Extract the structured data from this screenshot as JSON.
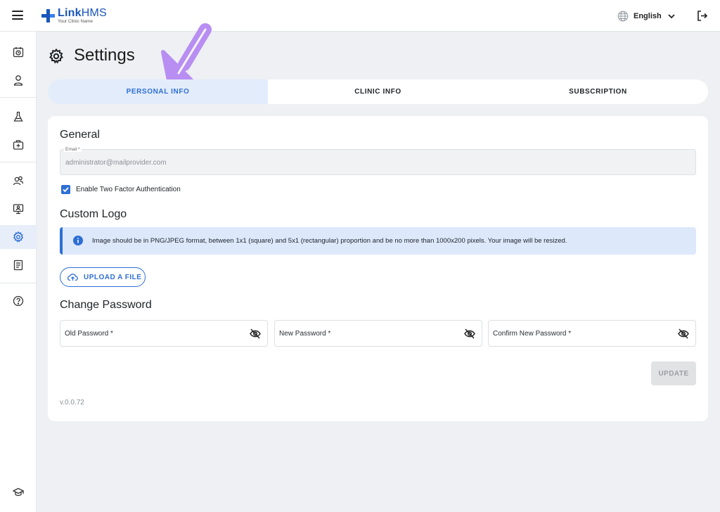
{
  "app": {
    "logo_name": "Link",
    "logo_name_suffix": "HMS",
    "logo_subtitle": "Your Clinic Name"
  },
  "header": {
    "language": "English"
  },
  "sidebar": {
    "items": [
      {
        "icon": "calendar-clock-icon"
      },
      {
        "icon": "person-icon"
      },
      {
        "icon": "lab-flask-icon"
      },
      {
        "icon": "medical-kit-icon"
      },
      {
        "icon": "patients-icon"
      },
      {
        "icon": "monitor-user-icon"
      },
      {
        "icon": "gear-icon",
        "active": true
      },
      {
        "icon": "report-list-icon"
      },
      {
        "icon": "help-icon"
      },
      {
        "icon": "graduation-cap-icon"
      }
    ]
  },
  "page": {
    "title": "Settings"
  },
  "tabs": [
    {
      "label": "PERSONAL INFO",
      "active": true
    },
    {
      "label": "CLINIC INFO",
      "active": false
    },
    {
      "label": "SUBSCRIPTION",
      "active": false
    }
  ],
  "general": {
    "heading": "General",
    "email_label": "Email *",
    "email_value": "administrator@mailprovider.com",
    "two_factor_label": "Enable Two Factor Authentication",
    "two_factor_checked": true
  },
  "custom_logo": {
    "heading": "Custom Logo",
    "info_text": "Image should be in PNG/JPEG format, between 1x1 (square) and 5x1 (rectangular) proportion and be no more than 1000x200 pixels. Your image will be resized.",
    "upload_label": "UPLOAD A FILE"
  },
  "change_password": {
    "heading": "Change Password",
    "old_label": "Old Password *",
    "new_label": "New Password *",
    "confirm_label": "Confirm New Password *",
    "update_label": "UPDATE"
  },
  "version": "v.0.0.72",
  "colors": {
    "accent": "#2e6fd6",
    "brand": "#1a56b8",
    "annotation_arrow": "#b88ef2"
  }
}
